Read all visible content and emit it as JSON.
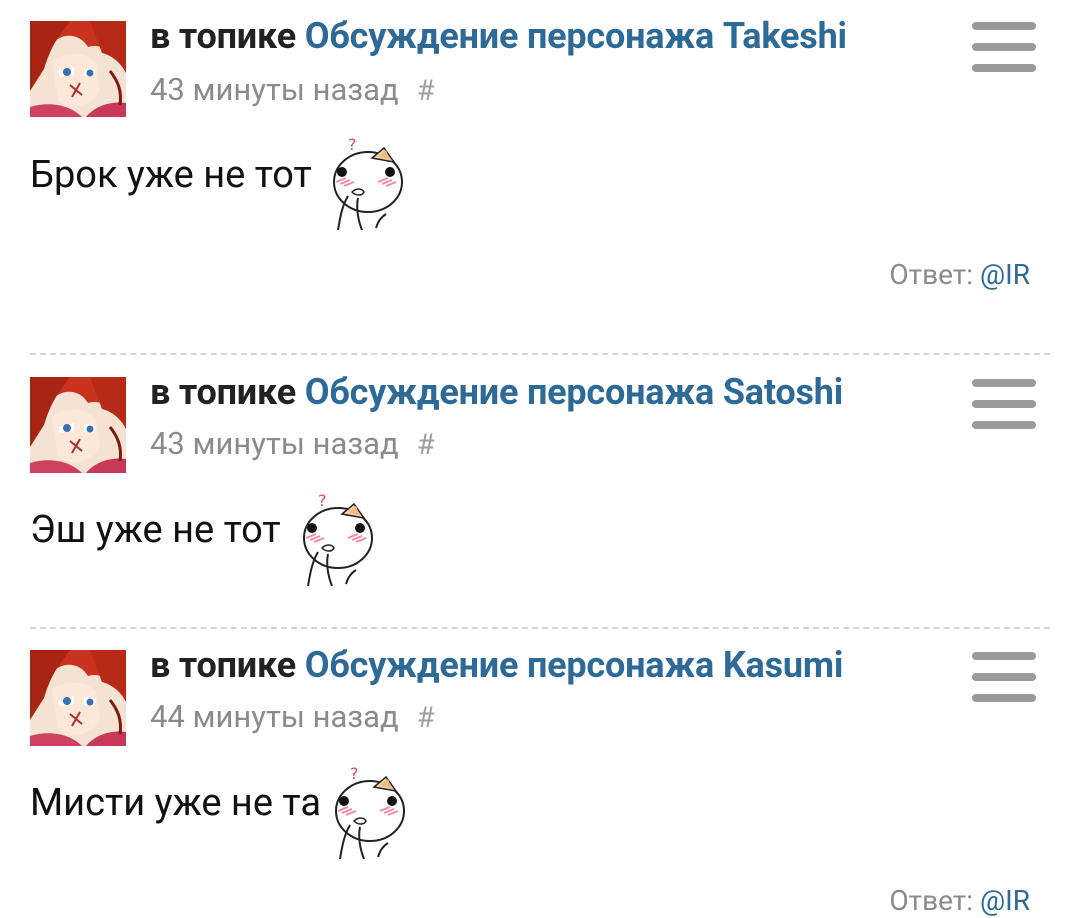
{
  "posts": [
    {
      "prefix": "в топике",
      "topic": "Обсуждение персонажа Takeshi",
      "time": "43 минуты назад",
      "hash": "#",
      "text": "Брок уже не тот",
      "reply_label": "Ответ:",
      "reply_user": "@IR"
    },
    {
      "prefix": "в топике",
      "topic": "Обсуждение персонажа Satoshi",
      "time": "43 минуты назад",
      "hash": "#",
      "text": "Эш уже не тот"
    },
    {
      "prefix": "в топике",
      "topic": "Обсуждение персонажа Kasumi",
      "time": "44 минуты назад",
      "hash": "#",
      "text": "Мисти уже не та",
      "reply_label": "Ответ:",
      "reply_user": "@IR"
    }
  ],
  "colors": {
    "topic_link": "#2e6a97",
    "meta": "#8b8b8b",
    "menu": "#9a9a9a"
  },
  "icons": {
    "avatar": "red-haired-anime-avatar",
    "menu": "hamburger-menu-icon",
    "emoticon": "thinking-cat-smiley-icon"
  }
}
